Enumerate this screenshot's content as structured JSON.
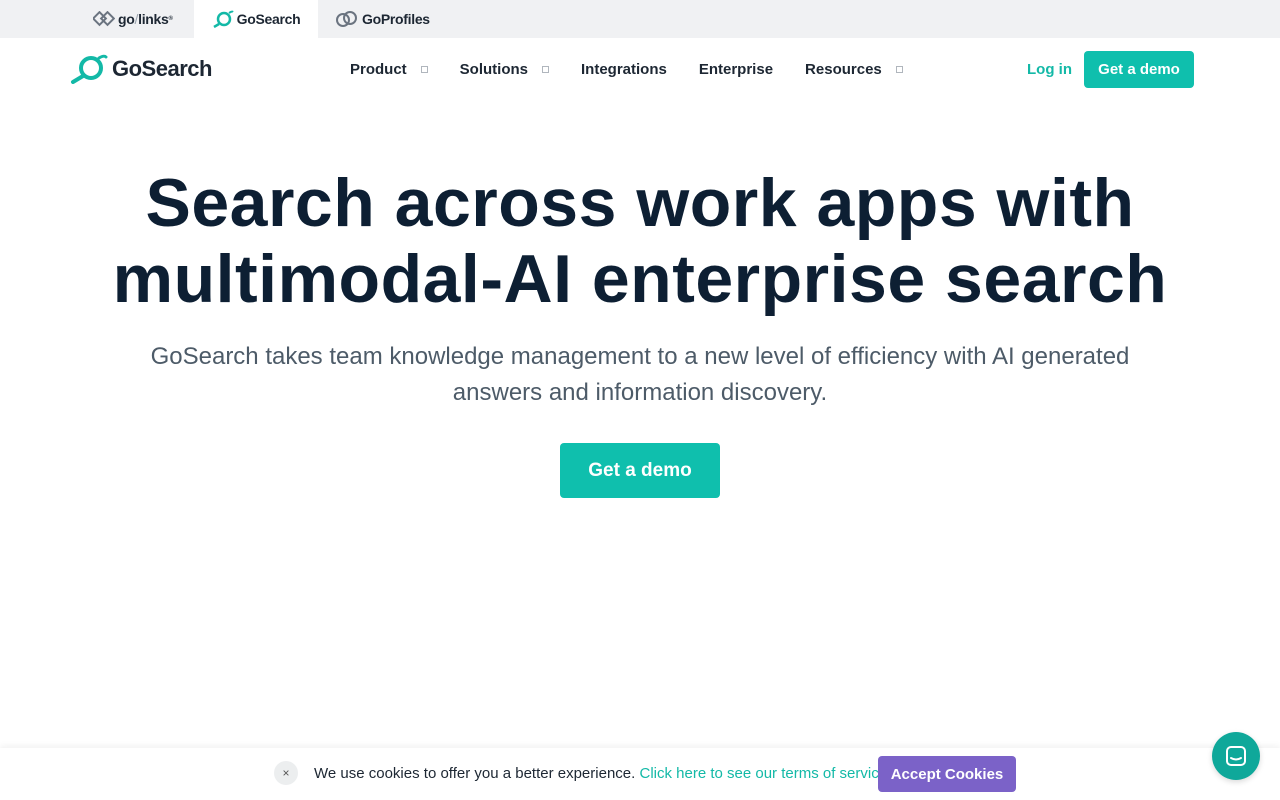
{
  "switcher": {
    "golinks": {
      "go": "go",
      "slash": "/",
      "links": "links",
      "mark": "®"
    },
    "gosearch": "GoSearch",
    "goprofiles": "GoProfiles"
  },
  "nav": {
    "brand": "GoSearch",
    "menu": [
      "Product",
      "Solutions",
      "Integrations",
      "Enterprise",
      "Resources"
    ],
    "login": "Log in",
    "demo": "Get a demo"
  },
  "hero": {
    "title_line1": "Search across work apps with",
    "title_line2": "multimodal-AI enterprise search",
    "subtitle": "GoSearch takes team knowledge management to a new level of efficiency with AI generated answers and information discovery.",
    "cta": "Get a demo"
  },
  "cookie": {
    "close": "×",
    "text": "We use cookies to offer you a better experience.",
    "link": "Click here to see our terms of service.",
    "accept": "Accept Cookies"
  },
  "colors": {
    "brand_teal": "#0fbfad",
    "accept_purple": "#7b62c8",
    "heading": "#0d1f33"
  },
  "icons": [
    "golinks-logo-icon",
    "gosearch-logo-icon",
    "goprofiles-logo-icon",
    "chevron-down-icon",
    "close-icon",
    "chat-icon"
  ]
}
